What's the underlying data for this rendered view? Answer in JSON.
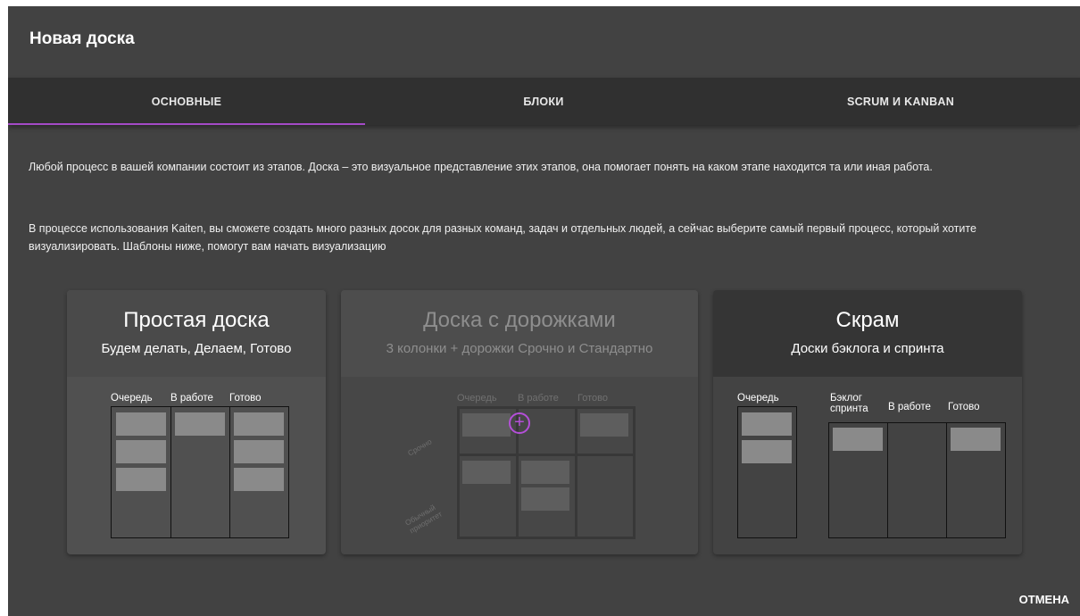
{
  "dialog": {
    "title": "Новая доска"
  },
  "tabs": [
    {
      "label": "ОСНОВНЫЕ",
      "active": true
    },
    {
      "label": "БЛОКИ",
      "active": false
    },
    {
      "label": "SCRUM И KANBAN",
      "active": false
    }
  ],
  "description": {
    "p1": "Любой процесс в вашей компании состоит из этапов. Доска – это визуальное представление этих этапов, она помогает понять на каком этапе находится та или иная работа.",
    "p2": "В процессе использования Kaiten, вы сможете создать много разных досок для разных команд, задач и отдельных людей, а сейчас выберите самый первый процесс, который хотите визуализировать. Шаблоны ниже, помогут вам начать визуализацию"
  },
  "cards": [
    {
      "title": "Простая доска",
      "subtitle": "Будем делать, Делаем, Готово",
      "columns": [
        "Очередь",
        "В работе",
        "Готово"
      ]
    },
    {
      "title": "Доска с дорожками",
      "subtitle": "3 колонки + дорожки Срочно и Стандартно",
      "columns": [
        "Очередь",
        "В работе",
        "Готово"
      ],
      "lanes": [
        "Срочно",
        "Обычный приоритет"
      ]
    },
    {
      "title": "Скрам",
      "subtitle": "Доски бэклога и спринта",
      "backlog_label": "Очередь",
      "sprint_columns": [
        "Бэклог спринта",
        "В работе",
        "Готово"
      ]
    }
  ],
  "footer": {
    "cancel_label": "ОТМЕНА"
  },
  "colors": {
    "accent": "#a44ac7",
    "dialog_bg": "#424242",
    "tabs_bg": "#303030"
  }
}
